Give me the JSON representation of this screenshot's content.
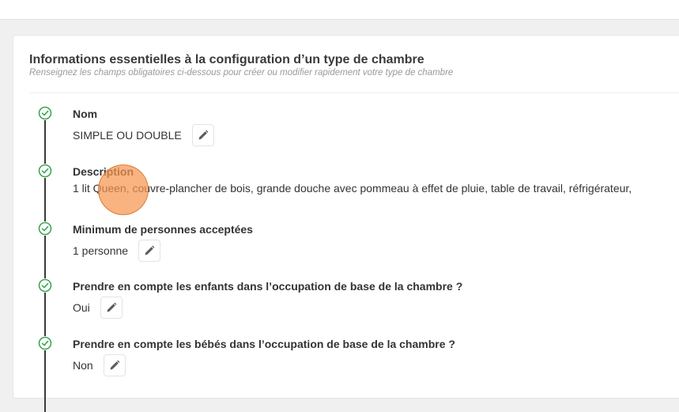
{
  "section": {
    "title": "Informations essentielles à la configuration d’un type de chambre",
    "subtitle": "Renseignez les champs obligatoires ci-dessous pour créer ou modifier rapidement votre type de chambre"
  },
  "steps": [
    {
      "label": "Nom",
      "value": "SIMPLE OU DOUBLE",
      "status": "completed"
    },
    {
      "label": "Description",
      "value": "1 lit Queen, couvre-plancher de bois, grande douche avec pommeau à effet de pluie, table de travail, réfrigérateur,",
      "status": "completed"
    },
    {
      "label": "Minimum de personnes acceptées",
      "value": "1 personne",
      "status": "completed"
    },
    {
      "label": "Prendre en compte les enfants dans l’occupation de base de la chambre ?",
      "value": "Oui",
      "status": "completed"
    },
    {
      "label": "Prendre en compte les bébés dans l’occupation de base de la chambre ?",
      "value": "Non",
      "status": "completed"
    }
  ],
  "icons": {
    "check": "check-circle-icon",
    "edit": "pencil-icon"
  },
  "colors": {
    "check_green": "#3fa653",
    "text_dark": "#333333",
    "subtitle_grey": "#9a9a9a",
    "click_marker": "#f59650"
  }
}
